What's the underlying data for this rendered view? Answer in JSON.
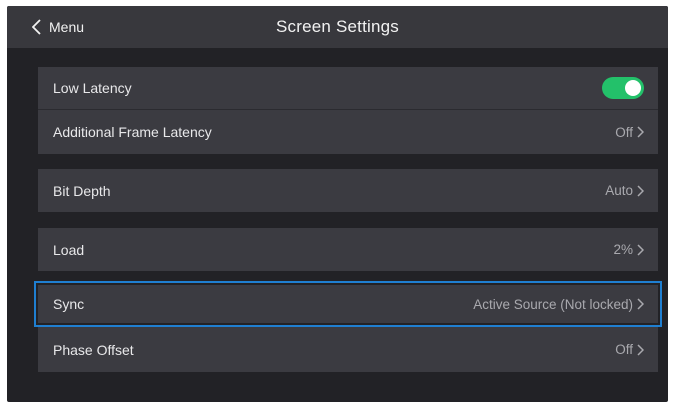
{
  "header": {
    "back_label": "Menu",
    "title": "Screen Settings"
  },
  "settings": [
    {
      "label": "Low Latency",
      "value": "",
      "toggle_on": true,
      "toggle_color": "#23c16a"
    },
    {
      "label": "Additional Frame Latency",
      "value": "Off"
    },
    {
      "label": "Bit Depth",
      "value": "Auto"
    },
    {
      "label": "Load",
      "value": "2%"
    },
    {
      "label": "Sync",
      "value": "Active Source (Not locked)",
      "selected": true
    },
    {
      "label": "Phase Offset",
      "value": "Off"
    }
  ],
  "colors": {
    "background": "#222226",
    "header": "#38383d",
    "row": "#3b3b41",
    "selection": "#1f7fd1"
  }
}
